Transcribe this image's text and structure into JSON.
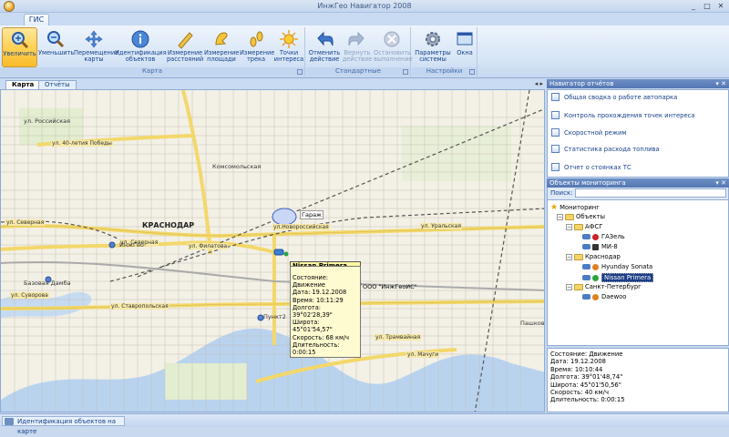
{
  "window": {
    "title": "ИнжГео Навигатор 2008"
  },
  "ribbon": {
    "tab": "ГИС",
    "groups": [
      {
        "label": "Карта",
        "buttons": [
          "Увеличить",
          "Уменьшить",
          "Перемещение карты",
          "Идентификация объектов",
          "Измерение расстояний",
          "Измерение площади",
          "Измерение трека",
          "Точки интереса"
        ]
      },
      {
        "label": "Стандартные",
        "buttons": [
          "Отменить действие",
          "Вернуть действие",
          "Остановить выполнение"
        ]
      },
      {
        "label": "Настройки",
        "buttons": [
          "Параметры системы",
          "Окна"
        ]
      }
    ]
  },
  "doc_tabs": [
    "Карта",
    "Отчёты"
  ],
  "map": {
    "city": "КРАСНОДАР",
    "garage": "Гараж",
    "company": "ООО \"ИнжГеоИС\"",
    "labels": {
      "pobedy": "ул. 40-летия Победы",
      "severnaya1": "ул. Северная",
      "severnaya2": "ул. Северная",
      "filatova": "ул. Филатова",
      "uralskaya": "ул. Уральская",
      "novorossiyskaya": "ул.Новороссийская",
      "stavropolskaya": "ул. Ставропольская",
      "tramvaynaya": "ул. Трамвайная",
      "machugi": "ул. Мачуги",
      "inzhgeo": "ИнжГео",
      "suvorova": "ул. Суворова",
      "bazovaya": "Базовая Дамба",
      "punkt": "Пункт2",
      "pashkov": "Пашков",
      "rossiyskaya": "ул. Российская",
      "koncevaya": "Комсомольская"
    },
    "popup": {
      "title": "Nissan Primera",
      "lines": [
        "Состояние: Движение",
        "Дата: 19.12.2008",
        "Время: 10:11:29",
        "Долгота: 39°02'28,39\"",
        "Широта: 45°01'54,57\"",
        "Скорость: 68 км/ч",
        "Длительность: 0:00:15"
      ]
    }
  },
  "reports_panel": {
    "title": "Навигатор отчётов",
    "items": [
      "Общая сводка о работе автопарка",
      "Контроль прохождения точек интереса",
      "Скоростной режим",
      "Статистика расхода топлива",
      "Отчет о стоянках ТС"
    ]
  },
  "objects_panel": {
    "title": "Объекты мониторинга",
    "search_label": "Поиск:",
    "search_value": "",
    "tree": {
      "root": "Мониторинг",
      "objects": "Объекты",
      "group1": "АФСГ",
      "g1_items": [
        "ГАЗель",
        "МИ-8"
      ],
      "group2": "Краснодар",
      "g2_items": [
        "Hyunday Sonata",
        "Nissan Primera"
      ],
      "group3": "Санкт-Петербург",
      "g3_items": [
        "Daewoo"
      ]
    }
  },
  "info_panel": {
    "lines": [
      "Состояние: Движение",
      "Дата: 19.12.2008",
      "Время: 10:10:44",
      "Долгота: 39°01'48,74\"",
      "Широта: 45°01'50,56\"",
      "Скорость: 40 км/ч",
      "Длительность: 0:00:15"
    ]
  },
  "status": {
    "text": "Идентификация объектов на карте"
  },
  "colors": {
    "ribbon_accent": "#15428b",
    "active_button": "#ffd257",
    "selection": "#1c3d87"
  }
}
